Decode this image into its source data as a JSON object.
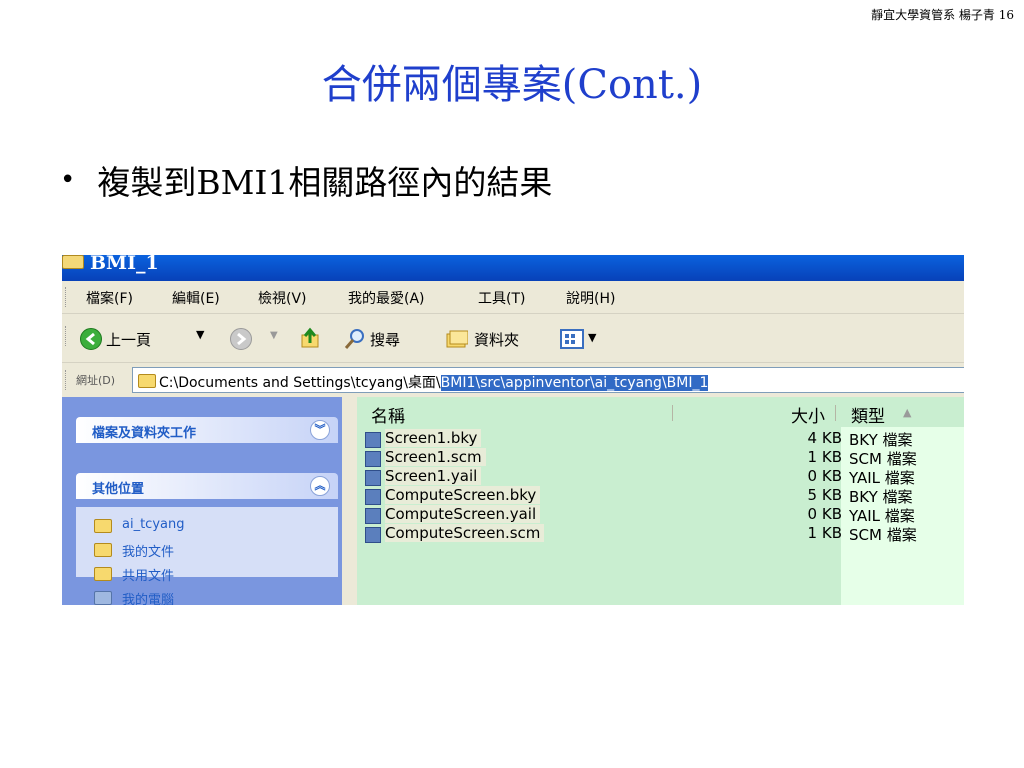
{
  "slide": {
    "credit": "靜宜大學資管系 楊子青 16",
    "title": "合併兩個專案(Cont.)",
    "bullet": "複製到BMI1相關路徑內的結果"
  },
  "explorer": {
    "window_title": "BMI_1",
    "menu": [
      "檔案(F)",
      "編輯(E)",
      "檢視(V)",
      "我的最愛(A)",
      "工具(T)",
      "說明(H)"
    ],
    "toolbar": {
      "back": "上一頁",
      "search": "搜尋",
      "folders": "資料夾"
    },
    "address": {
      "label": "網址(D)",
      "path_plain": "C:\\Documents and Settings\\tcyang\\桌面\\",
      "path_selected": "BMI1\\src\\appinventor\\ai_tcyang\\BMI_1"
    },
    "left_pane": {
      "tasks_title": "檔案及資料夾工作",
      "other_title": "其他位置",
      "links": [
        "ai_tcyang",
        "我的文件",
        "共用文件",
        "我的電腦"
      ]
    },
    "columns": {
      "name": "名稱",
      "size": "大小",
      "type": "類型"
    },
    "files": [
      {
        "name": "Screen1.bky",
        "size": "4 KB",
        "type": "BKY 檔案"
      },
      {
        "name": "Screen1.scm",
        "size": "1 KB",
        "type": "SCM 檔案"
      },
      {
        "name": "Screen1.yail",
        "size": "0 KB",
        "type": "YAIL 檔案"
      },
      {
        "name": "ComputeScreen.bky",
        "size": "5 KB",
        "type": "BKY 檔案"
      },
      {
        "name": "ComputeScreen.yail",
        "size": "0 KB",
        "type": "YAIL 檔案"
      },
      {
        "name": "ComputeScreen.scm",
        "size": "1 KB",
        "type": "SCM 檔案"
      }
    ],
    "colors": {
      "title_text": "#1f3fcc",
      "titlebar": "#0a62de",
      "selection": "#316ac5",
      "file_pane": "#c9eed0",
      "sorted_column": "#e6ffe8",
      "left_pane": "#7a96df"
    }
  }
}
